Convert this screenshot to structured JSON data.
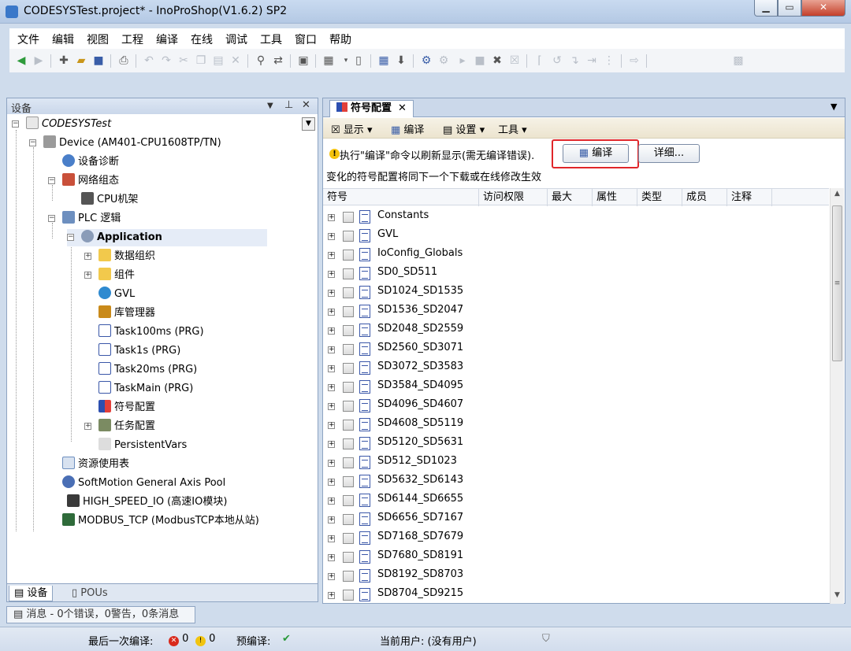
{
  "window": {
    "title": "CODESYSTest.project* - InoProShop(V1.6.2) SP2",
    "min": "▁",
    "max": "▭",
    "close": "✕"
  },
  "menu": [
    "文件",
    "编辑",
    "视图",
    "工程",
    "编译",
    "在线",
    "调试",
    "工具",
    "窗口",
    "帮助"
  ],
  "devices_panel": {
    "title": "设备",
    "tree": [
      {
        "label": "CODESYSTest",
        "icon": "project-icon"
      },
      {
        "label": "Device (AM401-CPU1608TP/TN)",
        "icon": "device-icon"
      },
      {
        "label": "设备诊断",
        "icon": "diagnose-icon"
      },
      {
        "label": "网络组态",
        "icon": "network-icon"
      },
      {
        "label": "CPU机架",
        "icon": "rack-icon"
      },
      {
        "label": "PLC 逻辑",
        "icon": "plc-logic-icon"
      },
      {
        "label": "Application",
        "icon": "application-gear-icon"
      },
      {
        "label": "数据组织",
        "icon": "folder-icon"
      },
      {
        "label": "组件",
        "icon": "folder-icon"
      },
      {
        "label": "GVL",
        "icon": "globe-icon"
      },
      {
        "label": "库管理器",
        "icon": "library-icon"
      },
      {
        "label": "Task100ms (PRG)",
        "icon": "ladder-pou-icon"
      },
      {
        "label": "Task1s (PRG)",
        "icon": "st-pou-icon"
      },
      {
        "label": "Task20ms (PRG)",
        "icon": "ladder-pou-icon"
      },
      {
        "label": "TaskMain (PRG)",
        "icon": "st-pou-icon"
      },
      {
        "label": "符号配置",
        "icon": "symbol-config-icon"
      },
      {
        "label": "任务配置",
        "icon": "task-config-icon"
      },
      {
        "label": "PersistentVars",
        "icon": "persistent-vars-icon"
      },
      {
        "label": "资源使用表",
        "icon": "resource-table-icon"
      },
      {
        "label": "SoftMotion General Axis Pool",
        "icon": "axis-pool-icon"
      },
      {
        "label": "HIGH_SPEED_IO (高速IO模块)",
        "icon": "io-module-icon"
      },
      {
        "label": "MODBUS_TCP (ModbusTCP本地从站)",
        "icon": "modbus-icon"
      }
    ],
    "tabs": {
      "devices": "设备",
      "pous": "POUs"
    }
  },
  "messages_tab": "消息 - 0个错误，0警告，0条消息",
  "statusbar": {
    "last_compile_label": "最后一次编译:",
    "errors": "0",
    "warnings": "0",
    "precompile_label": "预编译:",
    "precompile_ok": "✔",
    "current_user": "当前用户: (没有用户)"
  },
  "editor": {
    "tab_title": "符号配置",
    "tab_close": "✕",
    "toolbar": {
      "display": "显示",
      "compile": "编译",
      "settings": "设置",
      "tools": "工具"
    },
    "info_text": "执行\"编译\"命令以刷新显示(需无编译错误).",
    "compile_button": "编译",
    "detail_button": "详细...",
    "note": "变化的符号配置将同下一个下载或在线修改生效",
    "columns": [
      "符号",
      "访问权限",
      "最大",
      "属性",
      "类型",
      "成员",
      "注释"
    ],
    "rows": [
      "Constants",
      "GVL",
      "IoConfig_Globals",
      "SD0_SD511",
      "SD1024_SD1535",
      "SD1536_SD2047",
      "SD2048_SD2559",
      "SD2560_SD3071",
      "SD3072_SD3583",
      "SD3584_SD4095",
      "SD4096_SD4607",
      "SD4608_SD5119",
      "SD5120_SD5631",
      "SD512_SD1023",
      "SD5632_SD6143",
      "SD6144_SD6655",
      "SD6656_SD7167",
      "SD7168_SD7679",
      "SD7680_SD8191",
      "SD8192_SD8703",
      "SD8704_SD9215"
    ]
  },
  "colors": {
    "highlight_box": "#e0262a",
    "title_bar": "#c9daf0",
    "editor_toolbar": "#f1ebda"
  }
}
